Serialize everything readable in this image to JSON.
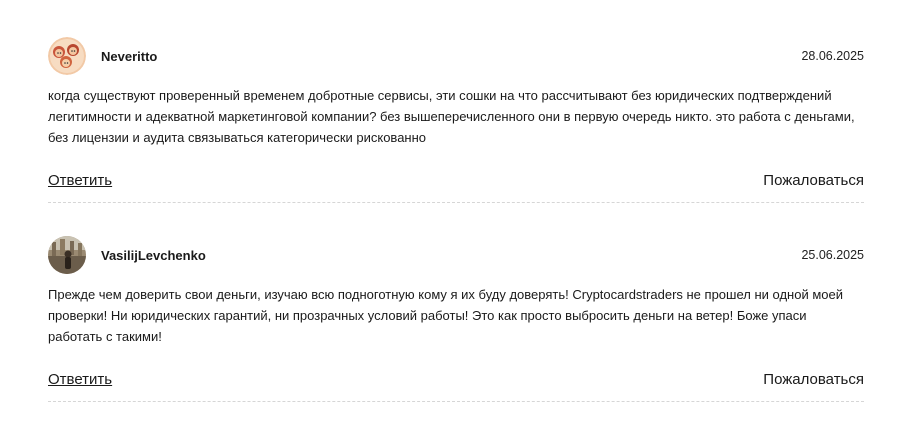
{
  "comments": [
    {
      "author": "Neveritto",
      "date": "28.06.2025",
      "avatar_icon": "avatar-cartoon-icon",
      "text": "когда существуют проверенный временем добротные сервисы, эти сошки на что рассчитывают без юридических подтверждений легитимности и адекватной маркетинговой компании? без вышеперечисленного они в первую очередь никто. это работа с деньгами, без лицензии и аудита связываться категорически рискованно",
      "reply_label": "Ответить",
      "report_label": "Пожаловаться"
    },
    {
      "author": "VasilijLevchenko",
      "date": "25.06.2025",
      "avatar_icon": "avatar-photo-icon",
      "text": "Прежде чем доверить свои деньги, изучаю всю подноготную кому я их буду доверять! Cryptocardstraders не прошел ни одной моей проверки! Ни юридических гарантий, ни прозрачных условий работы! Это как просто выбросить деньги на ветер! Боже упаси работать с такими!",
      "reply_label": "Ответить",
      "report_label": "Пожаловаться"
    }
  ],
  "colors": {
    "text": "#1a1a1a",
    "divider": "#d6d6d6",
    "background": "#ffffff"
  }
}
